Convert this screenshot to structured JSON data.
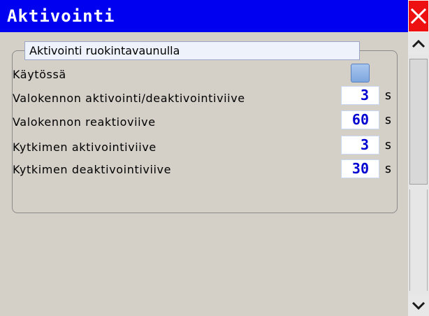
{
  "window": {
    "title": "Aktivointi"
  },
  "group": {
    "title": "Aktivointi ruokintavaunulla"
  },
  "enabled": {
    "label": "Käytössä",
    "checked": false
  },
  "rows": [
    {
      "label": "Valokennon aktivointi/deaktivointiviive",
      "value": "3",
      "unit": "s"
    },
    {
      "label": "Valokennon reaktioviive",
      "value": "60",
      "unit": "s"
    },
    {
      "label": "Kytkimen aktivointiviive",
      "value": "3",
      "unit": "s"
    },
    {
      "label": "Kytkimen deaktivointiviive",
      "value": "30",
      "unit": "s"
    }
  ],
  "colors": {
    "titlebar": "#0000f0",
    "close": "#ee1111",
    "value_text": "#0000d0"
  },
  "icons": {
    "close": "close-icon",
    "scroll_up": "chevron-up-icon",
    "scroll_down": "chevron-down-icon"
  }
}
